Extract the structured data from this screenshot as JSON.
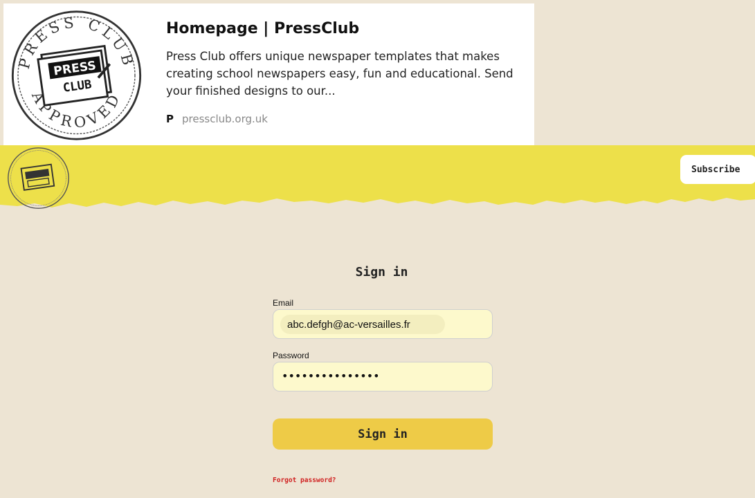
{
  "preview": {
    "title": "Homepage | PressClub",
    "description": "Press Club offers unique newspaper templates that makes creating school newspapers easy, fun and educational. Send your finished designs to our...",
    "favicon_letter": "P",
    "domain": "pressclub.org.uk"
  },
  "seal": {
    "ring_top": "PRESS CLUB",
    "ring_bottom": "APPROVED",
    "badge_line1": "PRESS",
    "badge_line2": "CLUB"
  },
  "header": {
    "subscribe_label": "Subscribe",
    "band_color": "#ede04a"
  },
  "form": {
    "title": "Sign in",
    "email_label": "Email",
    "email_value": "abc.defgh@ac-versailles.fr",
    "password_label": "Password",
    "password_value": "•••••••••••••••",
    "submit_label": "Sign in",
    "forgot_label": "Forgot password?"
  },
  "colors": {
    "page_bg": "#ede4d3",
    "accent_button": "#eecb47",
    "input_bg": "#fdf9cc",
    "forgot_link": "#d02020"
  }
}
